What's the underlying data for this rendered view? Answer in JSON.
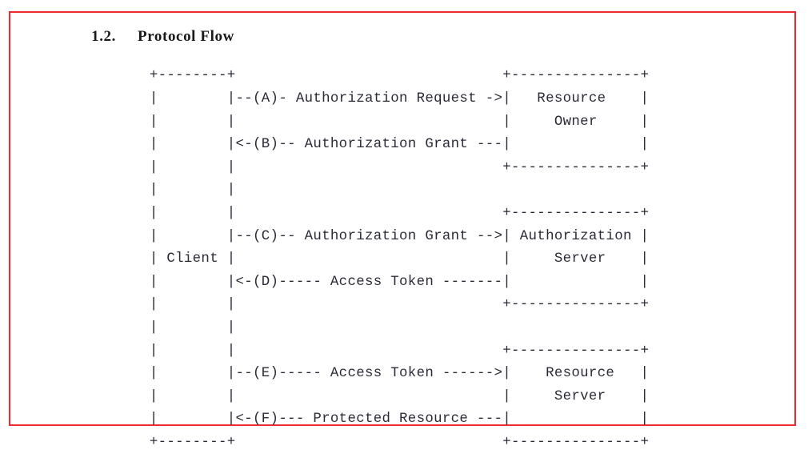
{
  "document": {
    "section_number": "1.2.",
    "section_title": "Protocol Flow",
    "highlight_border_color": "#ee2a2f",
    "text_color": "#2b2b38",
    "background_color": "#ffffff"
  },
  "diagram": {
    "type": "ascii-art-sequence-diagram",
    "name": "oauth-protocol-flow",
    "participants": [
      {
        "id": "client",
        "label": "Client"
      },
      {
        "id": "resource-owner",
        "label": "Resource Owner"
      },
      {
        "id": "authorization-server",
        "label": "Authorization Server"
      },
      {
        "id": "resource-server",
        "label": "Resource Server"
      }
    ],
    "steps": [
      {
        "tag": "(A)",
        "label": "Authorization Request",
        "direction": "->",
        "from": "client",
        "to": "resource-owner"
      },
      {
        "tag": "(B)",
        "label": "Authorization Grant",
        "direction": "<-",
        "from": "resource-owner",
        "to": "client"
      },
      {
        "tag": "(C)",
        "label": "Authorization Grant",
        "direction": "->",
        "from": "client",
        "to": "authorization-server"
      },
      {
        "tag": "(D)",
        "label": "Access Token",
        "direction": "<-",
        "from": "authorization-server",
        "to": "client"
      },
      {
        "tag": "(E)",
        "label": "Access Token",
        "direction": "->",
        "from": "client",
        "to": "resource-server"
      },
      {
        "tag": "(F)",
        "label": "Protected Resource",
        "direction": "<-",
        "from": "resource-server",
        "to": "client"
      }
    ],
    "art_lines": [
      "     +--------+                               +---------------+",
      "     |        |--(A)- Authorization Request ->|   Resource    |",
      "     |        |                               |     Owner     |",
      "     |        |<-(B)-- Authorization Grant ---|               |",
      "     |        |                               +---------------+",
      "     |        |",
      "     |        |                               +---------------+",
      "     |        |--(C)-- Authorization Grant -->| Authorization |",
      "     | Client |                               |     Server    |",
      "     |        |<-(D)----- Access Token -------|               |",
      "     |        |                               +---------------+",
      "     |        |",
      "     |        |                               +---------------+",
      "     |        |--(E)----- Access Token ------>|    Resource   |",
      "     |        |                               |     Server    |",
      "     |        |<-(F)--- Protected Resource ---|               |",
      "     +--------+                               +---------------+"
    ]
  }
}
